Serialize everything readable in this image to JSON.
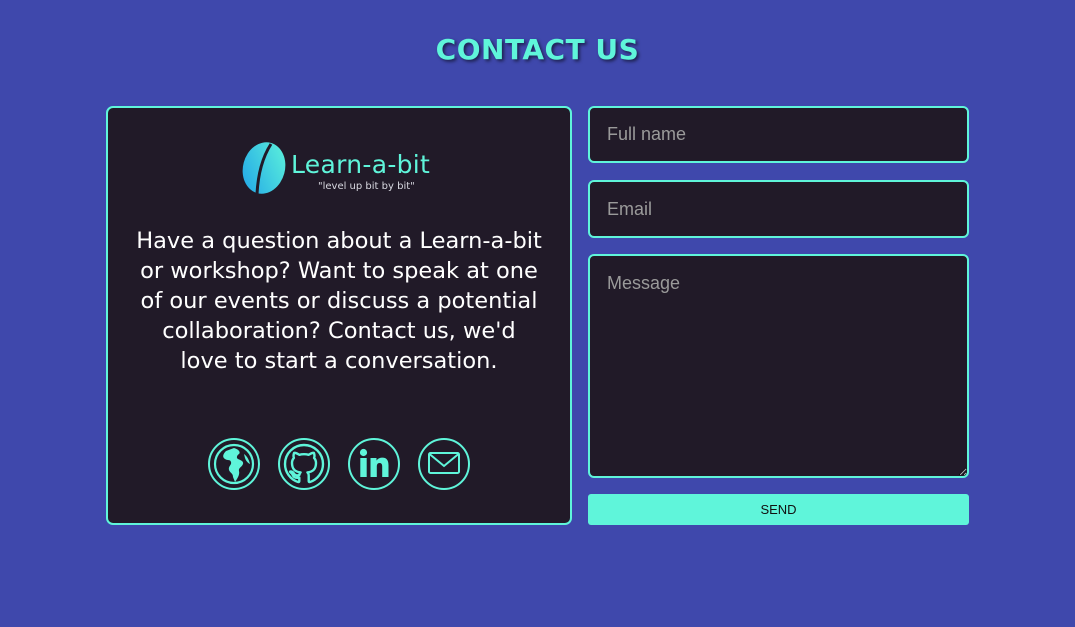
{
  "page": {
    "title": "CONTACT US"
  },
  "info": {
    "logo_name": "Learn-a-bit",
    "logo_tagline": "\"level up bit by bit\"",
    "blurb": "Have a question about a Learn-a-bit or workshop? Want to speak at one of our events or discuss a potential collaboration? Contact us, we'd love to start a conversation.",
    "socials": [
      {
        "name": "website",
        "icon": "globe-icon"
      },
      {
        "name": "github",
        "icon": "github-icon"
      },
      {
        "name": "linkedin",
        "icon": "linkedin-icon"
      },
      {
        "name": "email",
        "icon": "envelope-icon"
      }
    ]
  },
  "form": {
    "name_placeholder": "Full name",
    "email_placeholder": "Email",
    "message_placeholder": "Message",
    "name_value": "",
    "email_value": "",
    "message_value": "",
    "send_label": "SEND"
  },
  "colors": {
    "background": "#3f48ac",
    "accent": "#5ff5da",
    "card": "#211a28",
    "text": "#ffffff"
  }
}
